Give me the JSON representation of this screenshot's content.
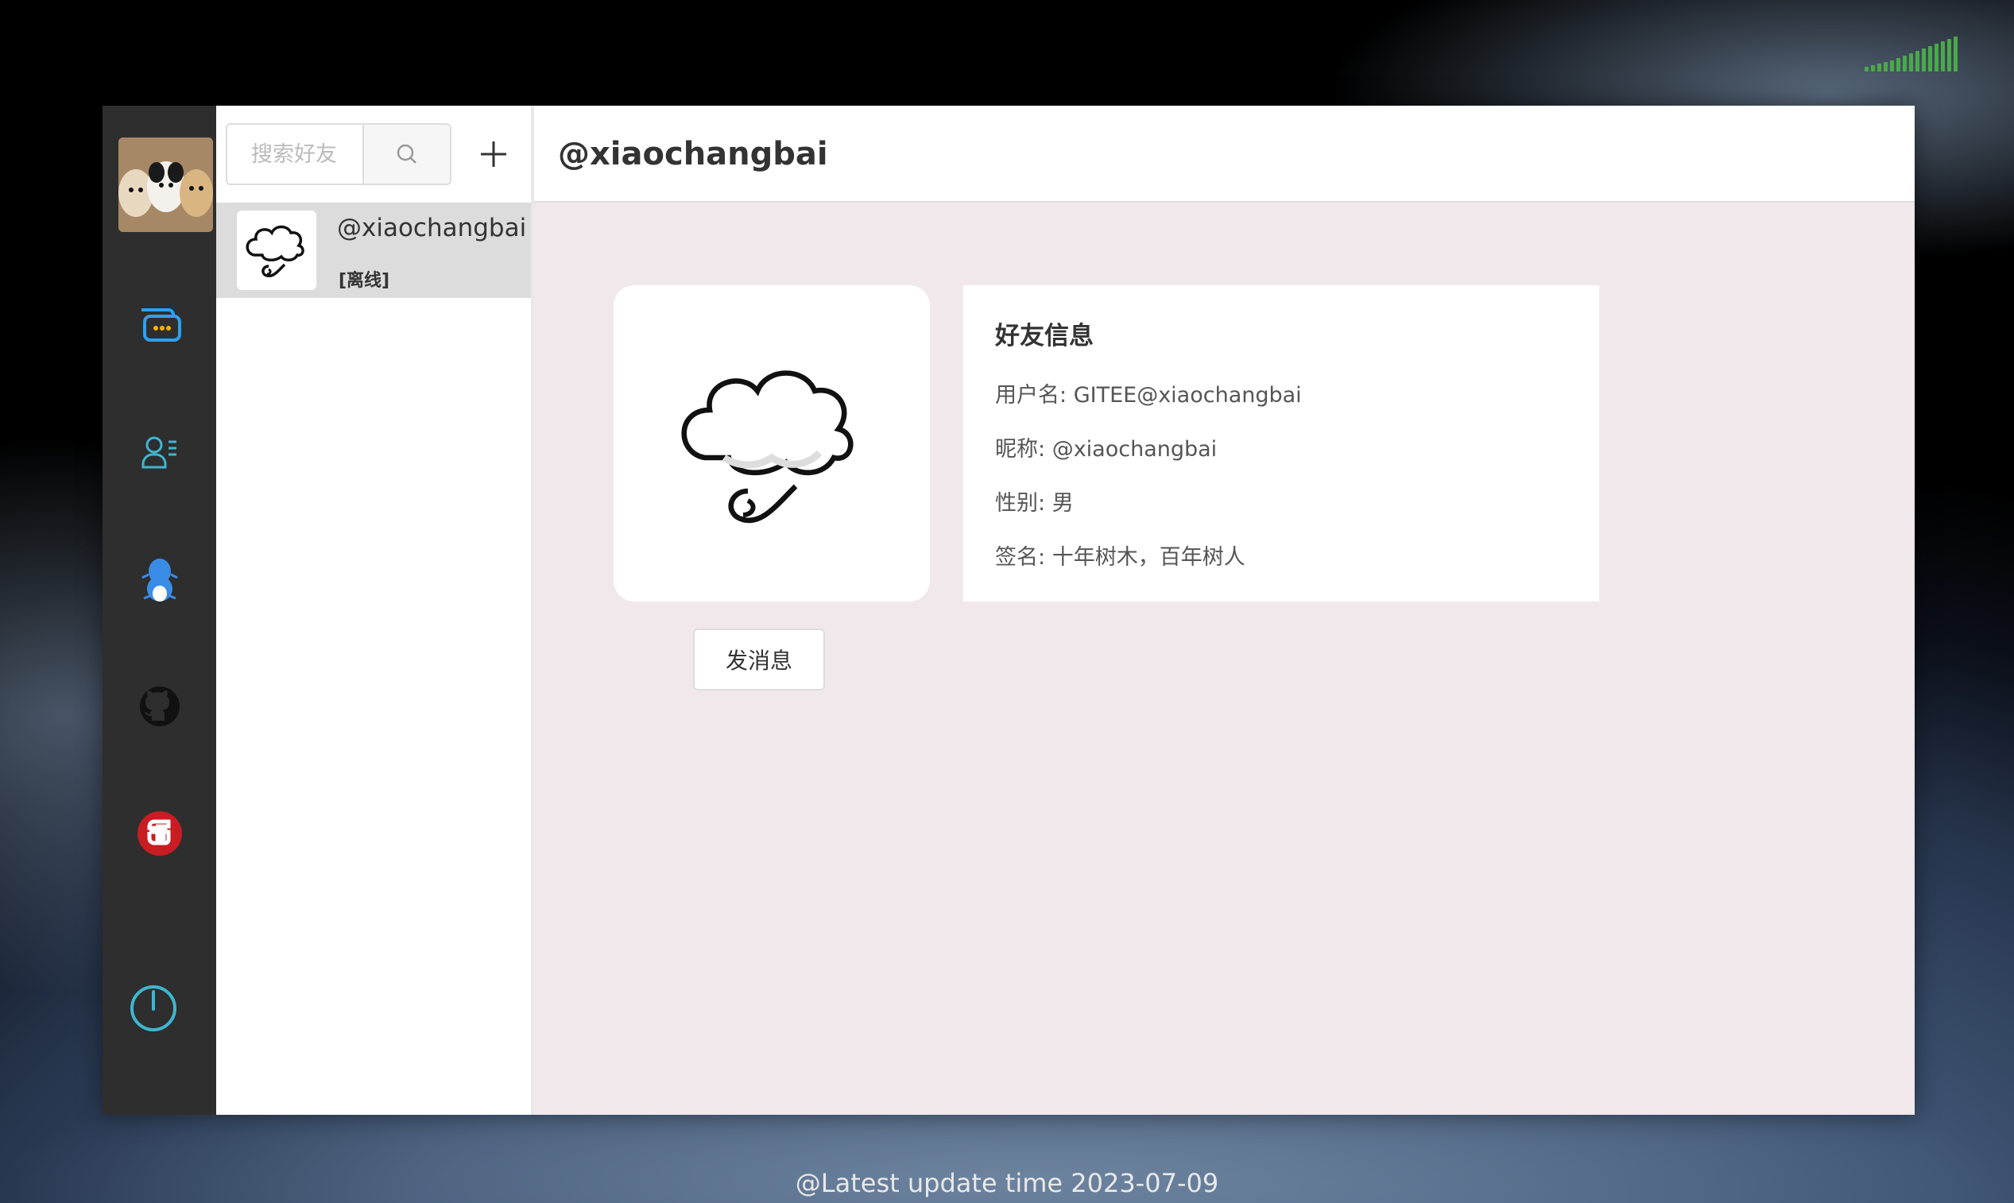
{
  "app": {
    "rail": {
      "items": [
        "avatar",
        "chat-icon",
        "contacts-icon",
        "qq-icon",
        "github-icon",
        "gitee-icon",
        "power-icon"
      ]
    },
    "friend_list": {
      "search_placeholder": "搜索好友",
      "items": [
        {
          "name": "@xiaochangbai",
          "status": "[离线]"
        }
      ]
    },
    "main": {
      "title": "@xiaochangbai",
      "send_button": "发消息",
      "info": {
        "heading": "好友信息",
        "username_label": "用户名:",
        "username": "GITEE@xiaochangbai",
        "nickname_label": "昵称:",
        "nickname": "@xiaochangbai",
        "gender_label": "性别:",
        "gender": "男",
        "signature_label": "签名:",
        "signature": "十年树木，百年树人"
      }
    }
  },
  "footer": {
    "text": "@Latest update time 2023-07-09"
  },
  "colors": {
    "rail_bg": "#2e2e2e",
    "main_bg": "#f1e8ec",
    "selected_item_bg": "#dcdcdc",
    "accent_blue": "#2ea0f0",
    "gitee_red": "#c71d23",
    "signal_green": "#4aa94a"
  }
}
